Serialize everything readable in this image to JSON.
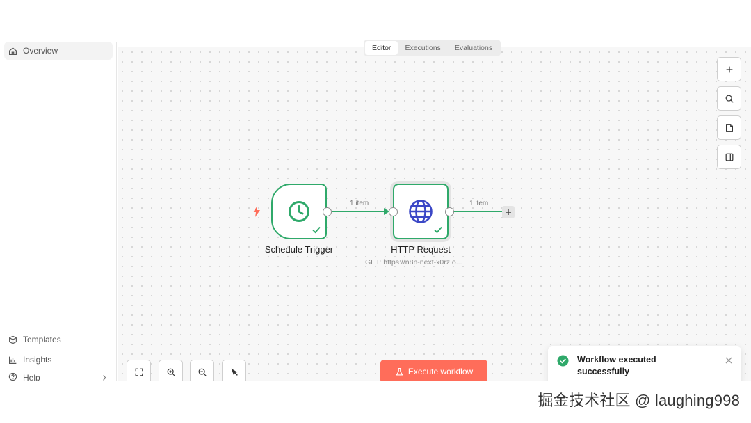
{
  "sidebar": {
    "items": [
      {
        "label": "Overview",
        "icon": "home-icon"
      },
      {
        "label": "Templates",
        "icon": "box-icon"
      },
      {
        "label": "Insights",
        "icon": "bar-chart-icon"
      },
      {
        "label": "Help",
        "icon": "help-circle-icon"
      }
    ]
  },
  "tabs": [
    {
      "label": "Editor",
      "active": true
    },
    {
      "label": "Executions",
      "active": false
    },
    {
      "label": "Evaluations",
      "active": false
    }
  ],
  "toolbar": {
    "icons": [
      "plus-icon",
      "search-icon",
      "sticky-note-icon",
      "panel-icon"
    ]
  },
  "nodes": {
    "trigger": {
      "label": "Schedule Trigger",
      "icon": "clock-icon"
    },
    "http": {
      "label": "HTTP Request",
      "subtitle": "GET: https://n8n-next-x0rz.o...",
      "icon": "globe-icon"
    }
  },
  "edges": [
    {
      "label": "1 item"
    },
    {
      "label": "1 item"
    }
  ],
  "controls": {
    "icons": [
      "fit-view-icon",
      "zoom-in-icon",
      "zoom-out-icon",
      "tidy-up-icon"
    ],
    "execute_label": "Execute workflow"
  },
  "toast": {
    "message": "Workflow executed successfully"
  },
  "watermark": "掘金技术社区 @ laughing998",
  "colors": {
    "success": "#2fa96a",
    "accent": "#ff6d5a",
    "trigger_bolt": "#ff6d5a",
    "globe": "#3b47c6"
  }
}
